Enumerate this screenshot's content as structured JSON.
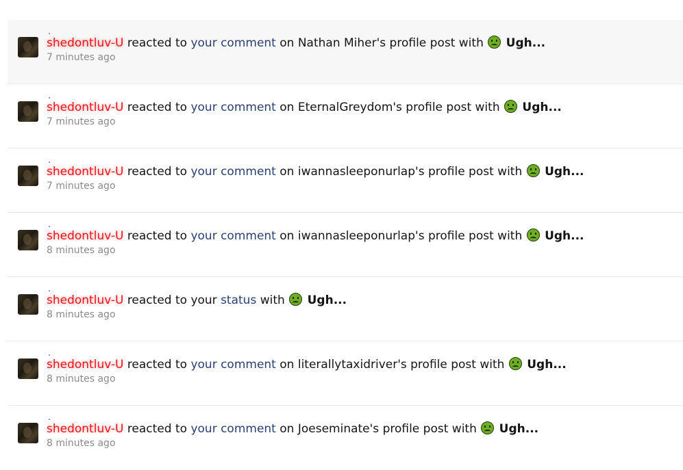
{
  "alerts": [
    {
      "user": "shedontluv-U",
      "text1": "reacted to",
      "link": "your comment",
      "text2": "on Nathan Miher's profile post with",
      "reaction": "Ugh...",
      "time": "7 minutes ago"
    },
    {
      "user": "shedontluv-U",
      "text1": "reacted to",
      "link": "your comment",
      "text2": "on EternalGreydom's profile post with",
      "reaction": "Ugh...",
      "time": "7 minutes ago"
    },
    {
      "user": "shedontluv-U",
      "text1": "reacted to",
      "link": "your comment",
      "text2": "on iwannasleeponurlap's profile post with",
      "reaction": "Ugh...",
      "time": "7 minutes ago"
    },
    {
      "user": "shedontluv-U",
      "text1": "reacted to",
      "link": "your comment",
      "text2": "on iwannasleeponurlap's profile post with",
      "reaction": "Ugh...",
      "time": "8 minutes ago"
    },
    {
      "user": "shedontluv-U",
      "text1": "reacted to your",
      "link": "status",
      "text2": "with",
      "reaction": "Ugh...",
      "time": "8 minutes ago"
    },
    {
      "user": "shedontluv-U",
      "text1": "reacted to",
      "link": "your comment",
      "text2": "on literallytaxidriver's profile post with",
      "reaction": "Ugh...",
      "time": "8 minutes ago"
    },
    {
      "user": "shedontluv-U",
      "text1": "reacted to",
      "link": "your comment",
      "text2": "on Joeseminate's profile post with",
      "reaction": "Ugh...",
      "time": "8 minutes ago"
    }
  ],
  "reaction_icon": "sick-face-icon",
  "colors": {
    "username": "#f0141a",
    "link": "#2b3f73",
    "highlight_row": "#f7f7f7"
  }
}
